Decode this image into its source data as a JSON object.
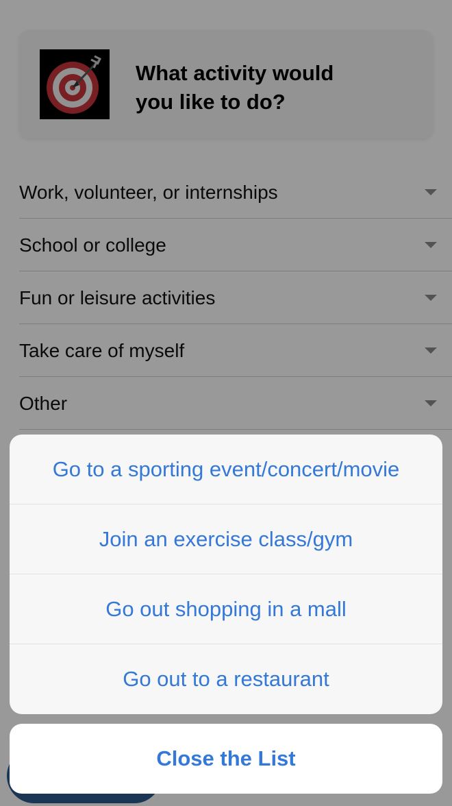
{
  "header": {
    "title": "What activity would\nyou like to do?",
    "icon": "target-dart-icon"
  },
  "categories": [
    {
      "label": "Work, volunteer, or internships"
    },
    {
      "label": "School or college"
    },
    {
      "label": "Fun or leisure activities"
    },
    {
      "label": "Take care of myself"
    },
    {
      "label": "Other"
    }
  ],
  "action_sheet": {
    "options": [
      {
        "label": "Go to a sporting event/concert/movie"
      },
      {
        "label": "Join an exercise class/gym"
      },
      {
        "label": "Go out shopping in a mall"
      },
      {
        "label": "Go out to a restaurant"
      }
    ],
    "close_label": "Close the List"
  },
  "colors": {
    "accent": "#3478d8",
    "overlay": "rgba(0,0,0,0.40)",
    "target_red": "#c7343a"
  }
}
